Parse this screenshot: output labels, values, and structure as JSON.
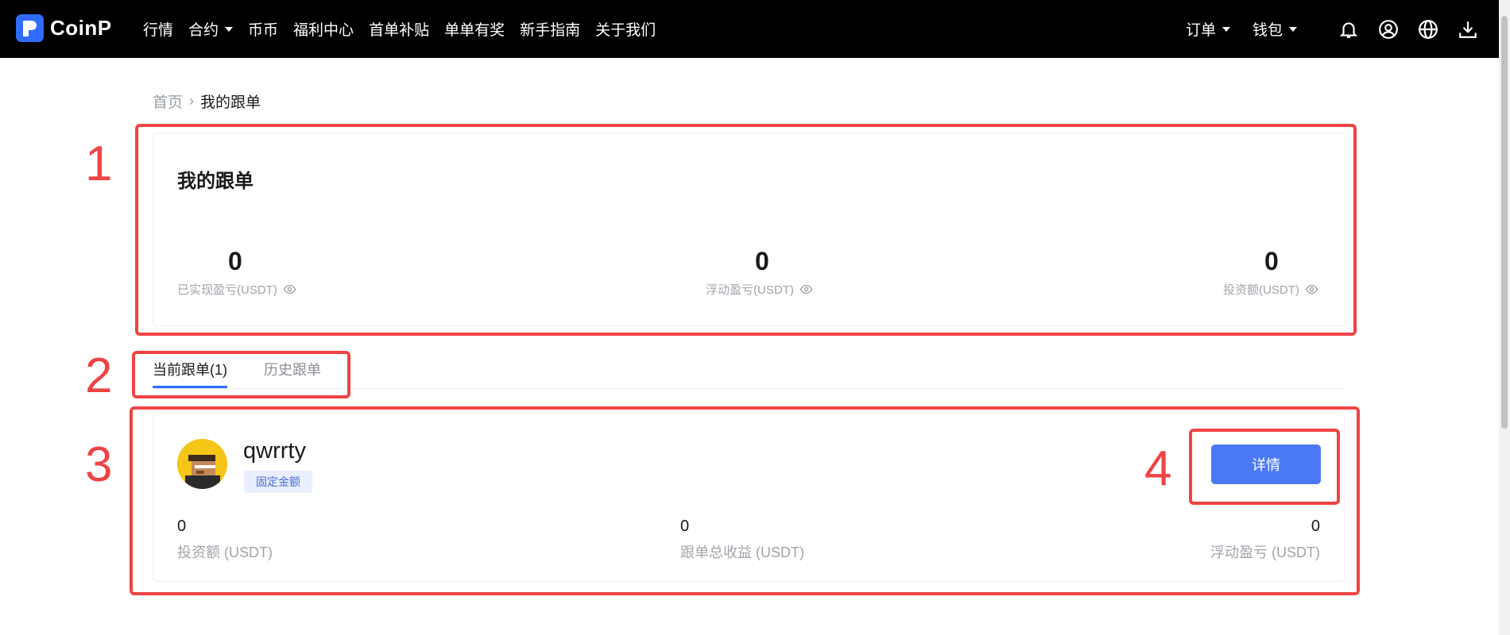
{
  "brand": {
    "name": "CoinP"
  },
  "nav": {
    "links": [
      "行情",
      "合约",
      "币币",
      "福利中心",
      "首单补贴",
      "单单有奖",
      "新手指南",
      "关于我们"
    ],
    "right": {
      "orders": "订单",
      "wallet": "钱包"
    }
  },
  "breadcrumb": {
    "home": "首页",
    "separator": "›",
    "current": "我的跟单"
  },
  "summary": {
    "title": "我的跟单",
    "stats": [
      {
        "value": "0",
        "label": "已实现盈亏(USDT)"
      },
      {
        "value": "0",
        "label": "浮动盈亏(USDT)"
      },
      {
        "value": "0",
        "label": "投资额(USDT)"
      }
    ]
  },
  "tabs": [
    {
      "label": "当前跟单(1)",
      "active": true
    },
    {
      "label": "历史跟单",
      "active": false
    }
  ],
  "follow_card": {
    "trader_name": "qwrrty",
    "badge": "固定金额",
    "detail_button": "详情",
    "stats": [
      {
        "value": "0",
        "label": "投资额 (USDT)"
      },
      {
        "value": "0",
        "label": "跟单总收益 (USDT)"
      },
      {
        "value": "0",
        "label": "浮动盈亏 (USDT)"
      }
    ]
  },
  "annotations": [
    "1",
    "2",
    "3",
    "4"
  ],
  "colors": {
    "accent": "#2f6bff",
    "button": "#4b79f5",
    "annotation": "#ef4444",
    "nav_bg": "#000000"
  }
}
